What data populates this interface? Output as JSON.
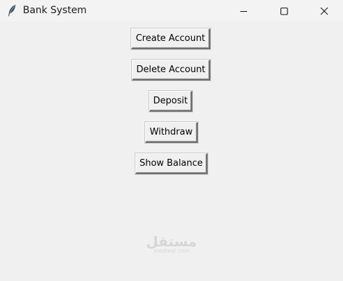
{
  "window": {
    "title": "Bank System",
    "app_icon": "feather-icon",
    "controls": {
      "minimize_icon": "minimize-icon",
      "maximize_icon": "maximize-icon",
      "close_icon": "close-icon"
    }
  },
  "buttons": {
    "create_account": "Create Account",
    "delete_account": "Delete Account",
    "deposit": "Deposit",
    "withdraw": "Withdraw",
    "show_balance": "Show Balance"
  },
  "watermark": {
    "arabic": "مستقل",
    "latin": "mostaql.com"
  },
  "colors": {
    "window_bg": "#f0f0f0",
    "titlebar_bg": "#f3f3f3",
    "watermark": "#d6d6d6"
  }
}
